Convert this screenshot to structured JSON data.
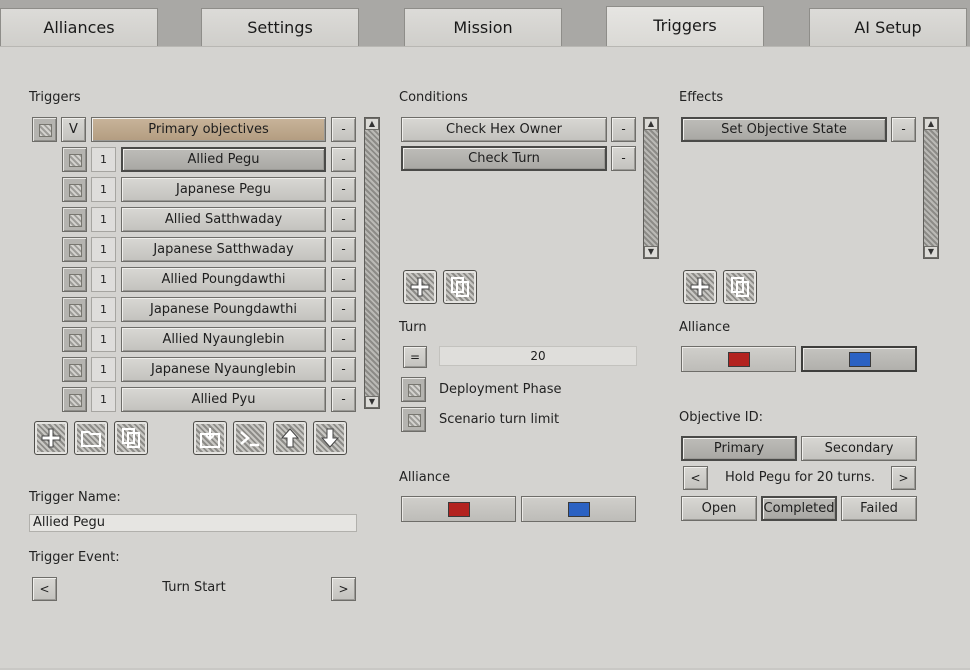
{
  "tabs": [
    {
      "label": "Alliances"
    },
    {
      "label": "Settings"
    },
    {
      "label": "Mission"
    },
    {
      "label": "Triggers"
    },
    {
      "label": "AI Setup"
    }
  ],
  "triggers": {
    "title": "Triggers",
    "group": {
      "toggle": "V",
      "label": "Primary objectives",
      "remove": "-"
    },
    "items": [
      {
        "num": "1",
        "label": "Allied Pegu",
        "remove": "-"
      },
      {
        "num": "1",
        "label": "Japanese Pegu",
        "remove": "-"
      },
      {
        "num": "1",
        "label": "Allied Satthwaday",
        "remove": "-"
      },
      {
        "num": "1",
        "label": "Japanese Satthwaday",
        "remove": "-"
      },
      {
        "num": "1",
        "label": "Allied Poungdawthi",
        "remove": "-"
      },
      {
        "num": "1",
        "label": "Japanese Poungdawthi",
        "remove": "-"
      },
      {
        "num": "1",
        "label": "Allied Nyaunglebin",
        "remove": "-"
      },
      {
        "num": "1",
        "label": "Japanese Nyaunglebin",
        "remove": "-"
      },
      {
        "num": "1",
        "label": "Allied Pyu",
        "remove": "-"
      }
    ],
    "toolbar_icons": [
      "add-icon",
      "folder-icon",
      "copy-icon",
      "import-icon",
      "console-icon",
      "arrow-up-icon",
      "arrow-down-icon"
    ],
    "name_label": "Trigger Name:",
    "name_value": "Allied Pegu",
    "event_label": "Trigger Event:",
    "event_value": "Turn Start",
    "prev": "<",
    "next": ">"
  },
  "conditions": {
    "title": "Conditions",
    "items": [
      {
        "label": "Check Hex Owner",
        "remove": "-"
      },
      {
        "label": "Check Turn",
        "remove": "-"
      }
    ],
    "turn_label": "Turn",
    "turn_op": "=",
    "turn_value": "20",
    "deployment_label": "Deployment Phase",
    "turn_limit_label": "Scenario turn limit",
    "alliance_label": "Alliance",
    "alliance_colors": [
      "#b3231f",
      "#2b62c3"
    ]
  },
  "effects": {
    "title": "Effects",
    "items": [
      {
        "label": "Set Objective State",
        "remove": "-"
      }
    ],
    "alliance_label": "Alliance",
    "alliance_colors": [
      "#b3231f",
      "#2b62c3"
    ],
    "objective_label": "Objective ID:",
    "primary": "Primary",
    "secondary": "Secondary",
    "prev": "<",
    "next": ">",
    "objective_text": "Hold Pegu for 20 turns.",
    "state_open": "Open",
    "state_completed": "Completed",
    "state_failed": "Failed"
  }
}
